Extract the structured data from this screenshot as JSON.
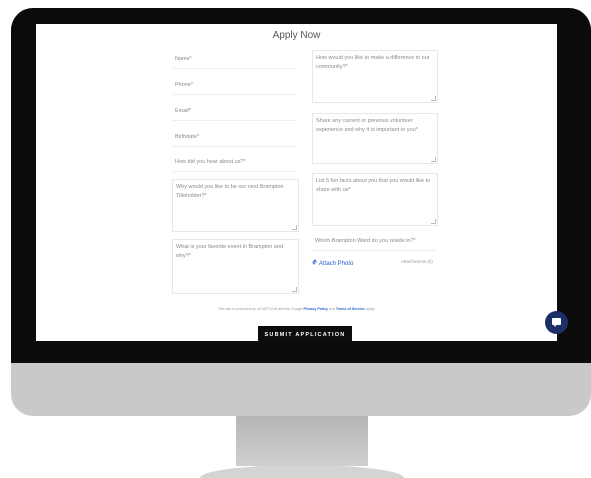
{
  "form": {
    "title": "Apply Now",
    "name_placeholder": "Name*",
    "phone_placeholder": "Phone*",
    "email_placeholder": "Email*",
    "birthdate_placeholder": "Birthdate*",
    "hear_placeholder": "How did you hear about us?*",
    "why_titleholder": "Why would you like to be our next Brampton Titleholder?*",
    "favorite_event": "What is your favorite event in Brampton and why?*",
    "difference": "How would you like to make a difference in our community?*",
    "volunteer": "Share any current or previous volunteer experience and why it is important to you*",
    "fun_facts": "List 5 fun facts about you that you would like to share with us*",
    "ward": "Which Brampton Ward do you reside in?*",
    "attach_label": "Attach Photo",
    "attachments_count": "Attachments (0)",
    "recaptcha_prefix": "This site is protected by reCAPTCHA and the Google",
    "privacy_link": "Privacy Policy",
    "and_text": "and",
    "terms_link": "Terms of Service",
    "apply_text": "apply.",
    "submit_label": "SUBMIT APPLICATION"
  },
  "icons": {
    "paperclip": "paperclip-icon",
    "chat": "chat-icon"
  },
  "colors": {
    "accent_link": "#2a5bd7",
    "submit_bg": "#0d0d0d",
    "chat_bg": "#1c2f66"
  }
}
